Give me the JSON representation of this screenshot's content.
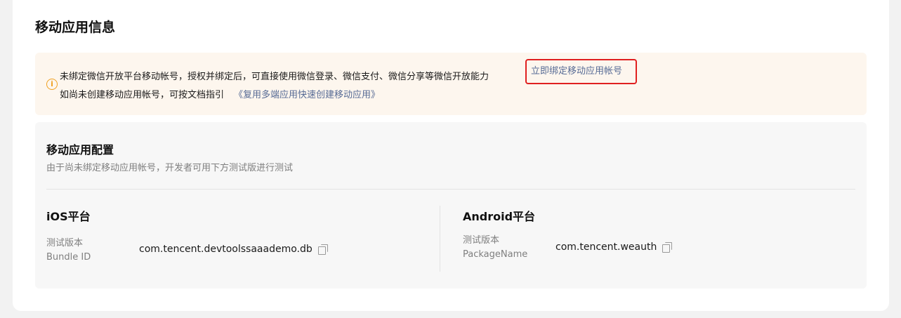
{
  "section": {
    "title": "移动应用信息"
  },
  "notice": {
    "line1": "未绑定微信开放平台移动帐号，授权并绑定后，可直接使用微信登录、微信支付、微信分享等微信开放能力",
    "bind_link": "立即绑定移动应用帐号",
    "line2": "如尚未创建移动应用帐号，可按文档指引",
    "doc_link": "《复用多端应用快速创建移动应用》",
    "icon": "info-icon",
    "accent_color": "#f0a020",
    "highlight_color": "#e02020"
  },
  "config": {
    "title": "移动应用配置",
    "desc": "由于尚未绑定移动应用帐号，开发者可用下方测试版进行测试",
    "ios": {
      "title": "iOS平台",
      "label1": "测试版本",
      "label2": "Bundle ID",
      "value": "com.tencent.devtoolssaaademo.db"
    },
    "android": {
      "title": "Android平台",
      "label1": "测试版本",
      "label2": "PackageName",
      "value": "com.tencent.weauth"
    }
  }
}
